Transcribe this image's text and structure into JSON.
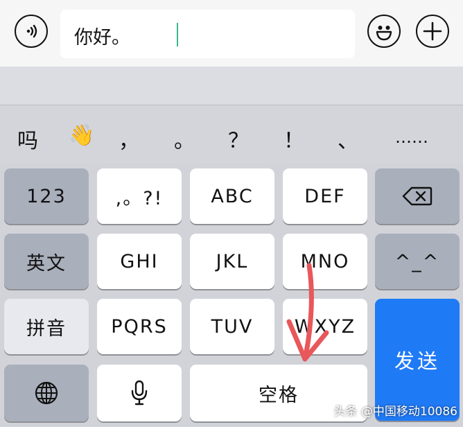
{
  "input_bar": {
    "text_value": "你好。"
  },
  "candidates": [
    "吗",
    "👋",
    "，",
    "。",
    "？",
    "！",
    "、",
    "……"
  ],
  "keyboard": {
    "row1": {
      "numbers": "123",
      "punct": ",。?!",
      "abc": "ABC",
      "def": "DEF"
    },
    "row2": {
      "english": "英文",
      "ghi": "GHI",
      "jkl": "JKL",
      "mno": "MNO",
      "emoticon": "^_^"
    },
    "row3": {
      "pinyin": "拼音",
      "pqrs": "PQRS",
      "tuv": "TUV",
      "wxyz": "WXYZ"
    },
    "row4": {
      "space": "空格"
    },
    "send": "发送"
  },
  "watermark": "头条 @中国移动10086",
  "colors": {
    "send": "#1f7af6",
    "annotation_arrow": "#e8575a",
    "caret": "#3ab58a"
  }
}
